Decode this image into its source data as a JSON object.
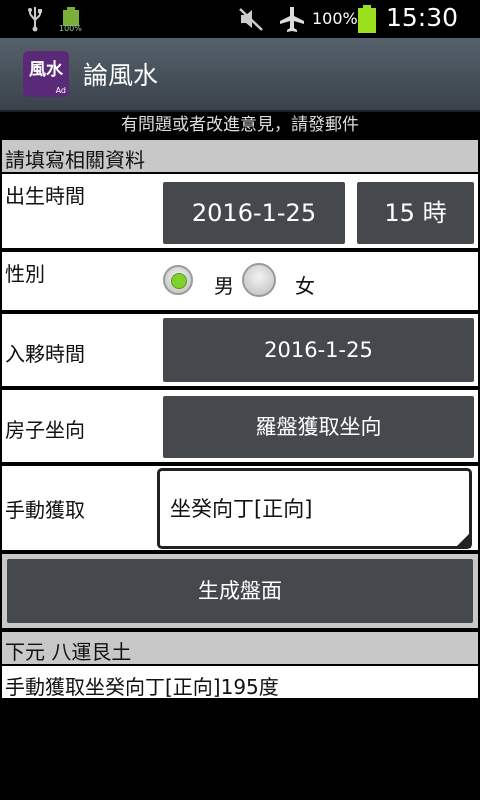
{
  "status_bar": {
    "small_battery_text": "100%",
    "battery_percent": "100%",
    "time": "15:30",
    "icons": [
      "usb-icon",
      "battery-small-icon",
      "mute-icon",
      "airplane-icon",
      "battery-icon"
    ]
  },
  "app": {
    "icon_text": "風水",
    "icon_badge": "Ad",
    "title": "論風水"
  },
  "feedback_text": "有問題或者改進意見，請發郵件",
  "form": {
    "header": "請填寫相關資料",
    "birth_time_label": "出生時間",
    "birth_date": "2016-1-25",
    "birth_hour": "15 時",
    "gender_label": "性別",
    "gender_options": [
      "男",
      "女"
    ],
    "gender_selected": "男",
    "move_in_label": "入夥時間",
    "move_in_date": "2016-1-25",
    "orientation_label": "房子坐向",
    "compass_button": "羅盤獲取坐向",
    "manual_label": "手動獲取",
    "manual_value": "坐癸向丁[正向]",
    "generate_button": "生成盤面"
  },
  "results": {
    "line1": "下元 八運艮土",
    "line2": "手動獲取坐癸向丁[正向]195度"
  },
  "colors": {
    "accent_green": "#7fd12b",
    "button_bg": "#45494d",
    "actionbar": "#4a545e",
    "battery": "#9be01c"
  }
}
